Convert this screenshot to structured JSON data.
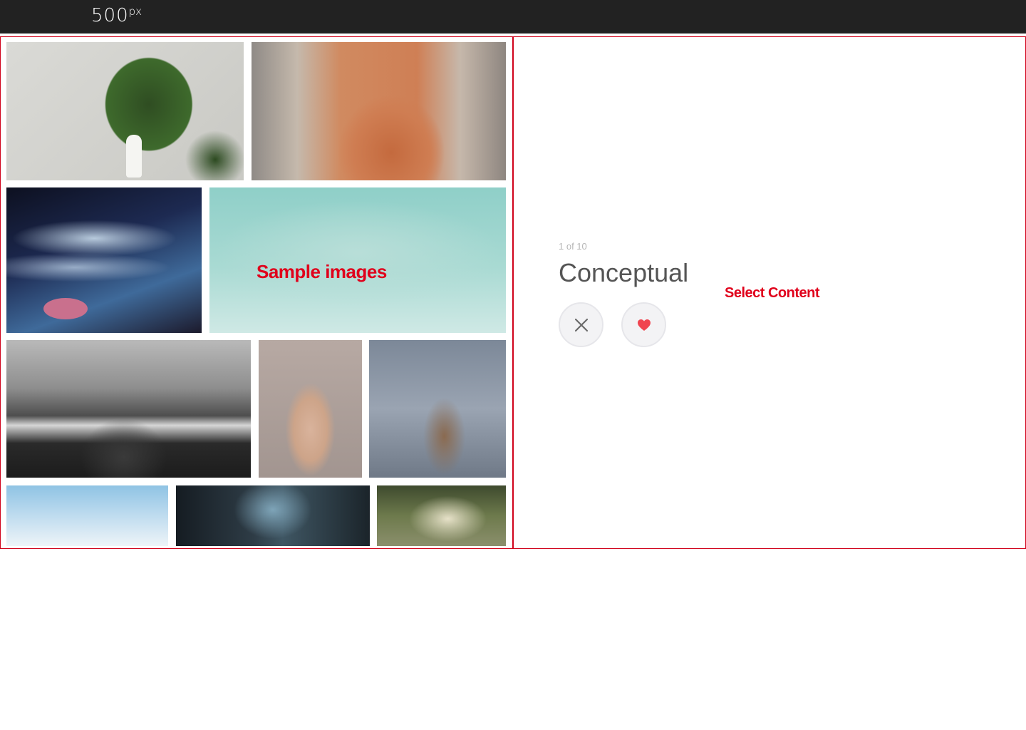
{
  "header": {
    "logo_main": "500",
    "logo_sup": "px"
  },
  "annotations": {
    "sample_images": "Sample images",
    "select_content": "Select Content"
  },
  "selector": {
    "counter": "1 of 10",
    "category": "Conceptual",
    "dislike_icon": "close-icon",
    "like_icon": "heart-icon"
  },
  "colors": {
    "topbar": "#222222",
    "annotation_red": "#e0001b",
    "like_red": "#f0444f",
    "dislike_gray": "#6b6b6b"
  }
}
